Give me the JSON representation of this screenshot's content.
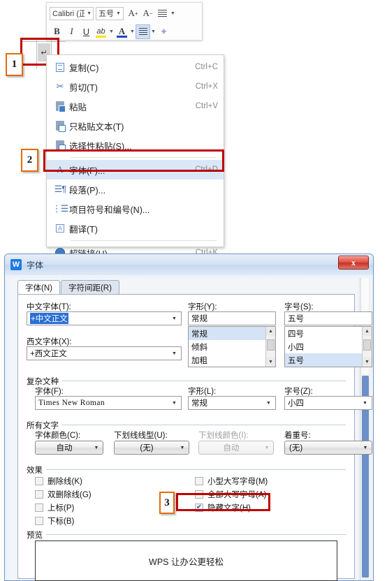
{
  "mini_toolbar": {
    "font_name": "Calibri (正",
    "font_size": "五号",
    "grow_font": "A+",
    "shrink_font": "A-",
    "line_spacing_icon": "line-spacing-icon",
    "bold": "B",
    "italic": "I",
    "underline": "U",
    "highlight": "ab",
    "font_color": "A",
    "align": "align-icon",
    "format_painter": "format-painter-icon"
  },
  "document": {
    "pilcrow": "↵"
  },
  "context_menu": {
    "items": [
      {
        "icon": "copy-icon",
        "label": "复制(C)",
        "accel": "Ctrl+C",
        "selected": false
      },
      {
        "icon": "cut-icon",
        "label": "剪切(T)",
        "accel": "Ctrl+X",
        "selected": false
      },
      {
        "icon": "paste-icon",
        "label": "粘贴",
        "accel": "Ctrl+V",
        "selected": false
      },
      {
        "icon": "paste-text-icon",
        "label": "只粘贴文本(T)",
        "accel": "",
        "selected": false
      },
      {
        "icon": "paste-special-icon",
        "label": "选择性粘贴(S)...",
        "accel": "",
        "selected": false
      },
      {
        "icon": "font-icon",
        "label": "字体(F)...",
        "accel": "Ctrl+D",
        "selected": true
      },
      {
        "icon": "paragraph-icon",
        "label": "段落(P)...",
        "accel": "",
        "selected": false
      },
      {
        "icon": "bullets-icon",
        "label": "项目符号和编号(N)...",
        "accel": "",
        "selected": false
      },
      {
        "icon": "translate-icon",
        "label": "翻译(T)",
        "accel": "",
        "selected": false
      },
      {
        "icon": "hyperlink-icon",
        "label": "超链接(H)...",
        "accel": "Ctrl+K",
        "selected": false
      }
    ]
  },
  "steps": {
    "one": "1",
    "two": "2",
    "three": "3"
  },
  "dialog": {
    "app_icon": "W",
    "title": "字体",
    "close_label": "x",
    "tabs": [
      {
        "label": "字体(N)",
        "active": true
      },
      {
        "label": "字符间距(R)",
        "active": false
      }
    ],
    "chinese_font": {
      "label": "中文字体(T):",
      "value": "+中文正文",
      "style_label": "字形(Y):",
      "style_value": "常规",
      "style_options": [
        "常规",
        "倾斜",
        "加粗"
      ],
      "style_selected": "常规",
      "size_label": "字号(S):",
      "size_value": "五号",
      "size_options": [
        "四号",
        "小四",
        "五号"
      ],
      "size_selected": "五号"
    },
    "western_font": {
      "label": "西文字体(X):",
      "value": "+西文正文"
    },
    "complex_script": {
      "group_title": "复杂文种",
      "font_label": "字体(F):",
      "font_value": "Times New Roman",
      "style_label": "字形(L):",
      "style_value": "常规",
      "size_label": "字号(Z):",
      "size_value": "小四"
    },
    "all_text": {
      "group_title": "所有文字",
      "color_label": "字体颜色(C):",
      "color_value": "自动",
      "underline_style_label": "下划线线型(U):",
      "underline_style_value": "(无)",
      "underline_color_label": "下划线颜色(I):",
      "underline_color_value": "自动",
      "emphasis_label": "着重号:",
      "emphasis_value": "(无)"
    },
    "effects": {
      "group_title": "效果",
      "left_column": [
        {
          "label": "删除线(K)",
          "checked": false
        },
        {
          "label": "双删除线(G)",
          "checked": false
        },
        {
          "label": "上标(P)",
          "checked": false
        },
        {
          "label": "下标(B)",
          "checked": false
        }
      ],
      "right_column": [
        {
          "label": "小型大写字母(M)",
          "checked": false
        },
        {
          "label": "全部大写字母(A)",
          "checked": false
        },
        {
          "label": "隐藏文字(H)",
          "checked": true
        }
      ]
    },
    "preview": {
      "group_title": "预览",
      "sample_text": "WPS 让办公更轻松"
    }
  },
  "colors": {
    "highlight_red": "#c00000",
    "marker_orange": "#e36c0a",
    "menu_selection": "#d9e7f7",
    "field_selection": "#2a6fd4"
  }
}
